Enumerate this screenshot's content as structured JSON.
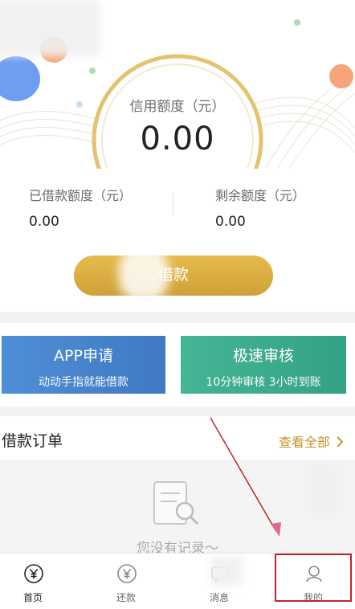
{
  "credit": {
    "label": "信用额度（元）",
    "value": "0.00"
  },
  "stats": {
    "borrowed_label": "已借款额度（元）",
    "borrowed_value": "0.00",
    "remaining_label": "剩余额度（元）",
    "remaining_value": "0.00"
  },
  "borrow_button": {
    "label": "借款"
  },
  "banners": [
    {
      "title": "APP申请",
      "subtitle": "动动手指就能借款"
    },
    {
      "title": "极速审核",
      "subtitle": "10分钟审核 3小时到账"
    }
  ],
  "orders": {
    "title": "借款订单",
    "view_all": "查看全部",
    "empty_text": "您没有记录～"
  },
  "tabs": [
    {
      "label": "首页",
      "icon": "yen-icon"
    },
    {
      "label": "还款",
      "icon": "yen-icon"
    },
    {
      "label": "消息",
      "icon": "message-icon"
    },
    {
      "label": "我的",
      "icon": "person-icon"
    }
  ],
  "colors": {
    "gold": "#d4a63f",
    "banner_blue": "#4a86cd",
    "banner_green": "#3dae8f",
    "highlight_red": "#c0242a"
  }
}
